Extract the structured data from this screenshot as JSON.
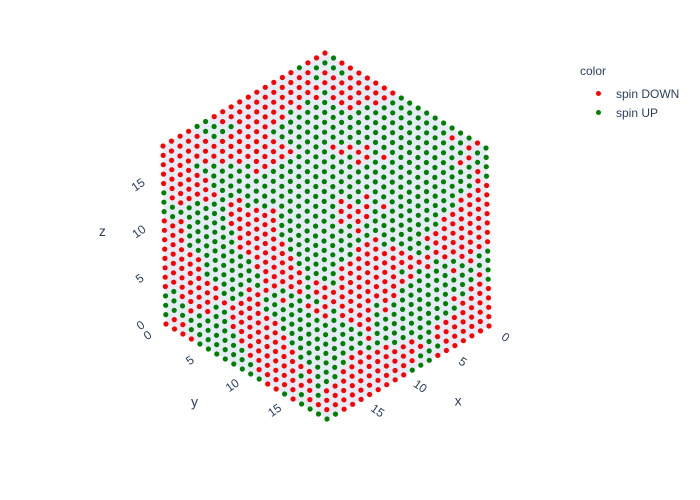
{
  "chart_data": {
    "type": "scatter",
    "subtype": "3d-scatter",
    "grid_size": 20,
    "axes": {
      "x": {
        "title": "x",
        "range": [
          0,
          19
        ],
        "ticks": [
          0,
          5,
          10,
          15
        ]
      },
      "y": {
        "title": "y",
        "range": [
          0,
          19
        ],
        "ticks": [
          0,
          5,
          10,
          15
        ]
      },
      "z": {
        "title": "z",
        "range": [
          0,
          19
        ],
        "ticks": [
          0,
          5,
          10,
          15
        ]
      }
    },
    "series": [
      {
        "name": "spin DOWN",
        "color": "#ff0000"
      },
      {
        "name": "spin UP",
        "color": "#008000"
      }
    ],
    "legend_title": "color",
    "legend_position": "top-right",
    "background": "#e5ecf6"
  },
  "legend": {
    "title": "color",
    "items": [
      {
        "label": "spin DOWN",
        "color": "#ff0000"
      },
      {
        "label": "spin UP",
        "color": "#008000"
      }
    ]
  }
}
